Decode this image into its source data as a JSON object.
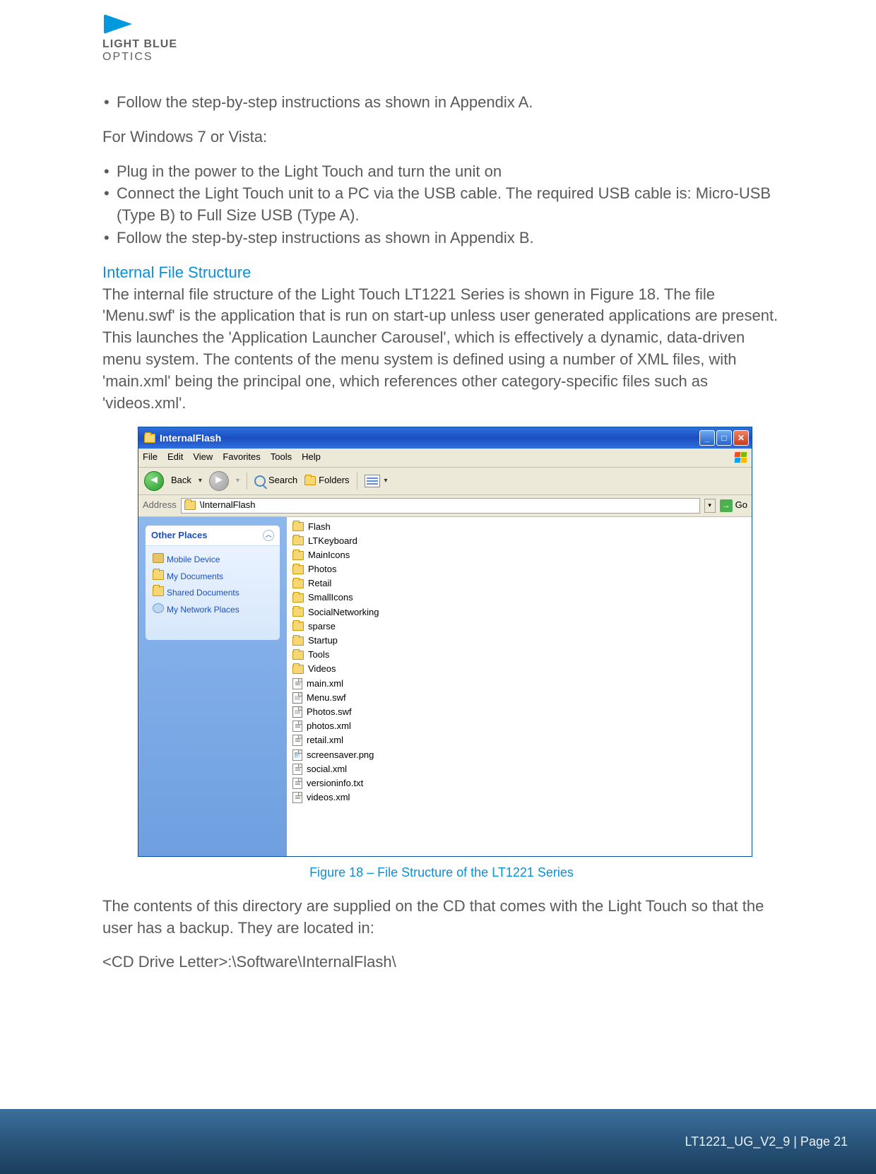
{
  "brand": {
    "line1": "LIGHT BLUE",
    "line2": "OPTICS"
  },
  "body": {
    "list1": {
      "i0": "Follow the step-by-step instructions as shown in Appendix A."
    },
    "para1": "For Windows 7 or Vista:",
    "list2": {
      "i0": "Plug in the power to the Light Touch and turn the unit on",
      "i1": "Connect the Light Touch unit to a PC via the USB cable. The required USB cable is: Micro-USB (Type B) to Full Size USB (Type A).",
      "i2": "Follow the step-by-step instructions as shown in Appendix B."
    },
    "h1": "Internal File Structure",
    "para2": "The internal file structure of the Light Touch LT1221 Series is shown in Figure 18. The file 'Menu.swf' is the application that is run on start-up unless user generated applications are present. This launches the 'Application Launcher Carousel', which is effectively a dynamic, data-driven menu system. The contents of the menu system is defined using a number of XML files, with 'main.xml' being the principal one, which references other category-specific files such as 'videos.xml'.",
    "caption": "Figure 18 – File Structure of the LT1221 Series",
    "para3": "The contents of this directory are supplied on the CD that comes with the Light Touch so that the user has a backup. They are located in:",
    "para4": "<CD Drive Letter>:\\Software\\InternalFlash\\"
  },
  "explorer": {
    "title": "InternalFlash",
    "menu": {
      "file": "File",
      "edit": "Edit",
      "view": "View",
      "favorites": "Favorites",
      "tools": "Tools",
      "help": "Help"
    },
    "toolbar": {
      "back": "Back",
      "search": "Search",
      "folders": "Folders"
    },
    "address": {
      "label": "Address",
      "value": "\\InternalFlash",
      "go": "Go"
    },
    "side": {
      "title": "Other Places",
      "links": {
        "l0": "Mobile Device",
        "l1": "My Documents",
        "l2": "Shared Documents",
        "l3": "My Network Places"
      }
    },
    "files": {
      "f0": {
        "name": "Flash",
        "type": "folder"
      },
      "f1": {
        "name": "LTKeyboard",
        "type": "folder"
      },
      "f2": {
        "name": "MainIcons",
        "type": "folder"
      },
      "f3": {
        "name": "Photos",
        "type": "folder"
      },
      "f4": {
        "name": "Retail",
        "type": "folder"
      },
      "f5": {
        "name": "SmallIcons",
        "type": "folder"
      },
      "f6": {
        "name": "SocialNetworking",
        "type": "folder"
      },
      "f7": {
        "name": "sparse",
        "type": "folder"
      },
      "f8": {
        "name": "Startup",
        "type": "folder"
      },
      "f9": {
        "name": "Tools",
        "type": "folder"
      },
      "f10": {
        "name": "Videos",
        "type": "folder"
      },
      "f11": {
        "name": "main.xml",
        "type": "xml"
      },
      "f12": {
        "name": "Menu.swf",
        "type": "swf"
      },
      "f13": {
        "name": "Photos.swf",
        "type": "swf"
      },
      "f14": {
        "name": "photos.xml",
        "type": "xml"
      },
      "f15": {
        "name": "retail.xml",
        "type": "xml"
      },
      "f16": {
        "name": "screensaver.png",
        "type": "png"
      },
      "f17": {
        "name": "social.xml",
        "type": "xml"
      },
      "f18": {
        "name": "versioninfo.txt",
        "type": "txt"
      },
      "f19": {
        "name": "videos.xml",
        "type": "xml"
      }
    }
  },
  "footer": {
    "text": "LT1221_UG_V2_9 | Page 21"
  }
}
